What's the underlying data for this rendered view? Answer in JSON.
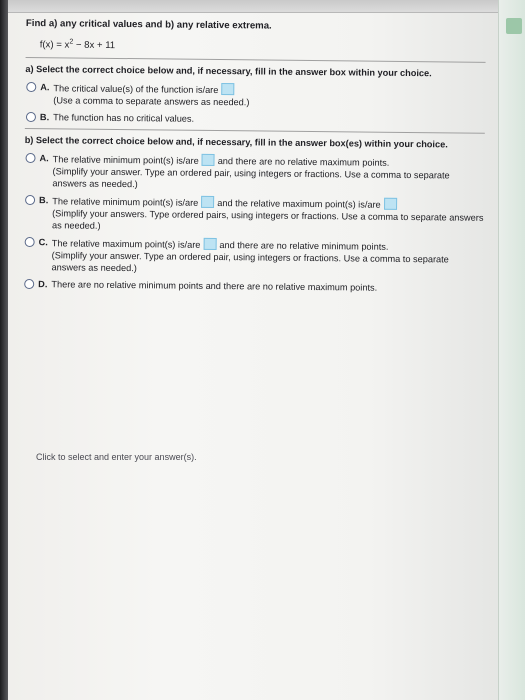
{
  "prompt": {
    "title": "Find a) any critical values and b) any relative extrema.",
    "function": {
      "lhs": "f(x) = x",
      "exponent": "2",
      "rest": " − 8x + 11"
    }
  },
  "part_a": {
    "question": "a) Select the correct choice below and, if necessary, fill in the answer box within your choice.",
    "options": [
      {
        "letter": "A.",
        "line1_before": "The critical value(s) of the function is/are",
        "line2": "(Use a comma to separate answers as needed.)"
      },
      {
        "letter": "B.",
        "line1": "The function has no critical values."
      }
    ]
  },
  "part_b": {
    "question": "b) Select the correct choice below and, if necessary, fill in the answer box(es) within your choice.",
    "options": [
      {
        "letter": "A.",
        "line1_before": "The relative minimum point(s) is/are",
        "line1_after": "and there are no relative maximum points.",
        "line2": "(Simplify your answer. Type an ordered pair, using integers or fractions. Use a comma to separate answers as needed.)"
      },
      {
        "letter": "B.",
        "line1_before": "The relative minimum point(s) is/are",
        "line1_middle": "and the relative maximum point(s) is/are",
        "line2": "(Simplify your answers. Type ordered pairs, using integers or fractions. Use a comma to separate answers as needed.)"
      },
      {
        "letter": "C.",
        "line1_before": "The relative maximum point(s) is/are",
        "line1_after": "and there are no relative minimum points.",
        "line2": "(Simplify your answer. Type an ordered pair, using integers or fractions. Use a comma to separate answers as needed.)"
      },
      {
        "letter": "D.",
        "line1": "There are no relative minimum points and there are no relative maximum points."
      }
    ]
  },
  "footer": {
    "text": "Click to select and enter your answer(s)."
  }
}
